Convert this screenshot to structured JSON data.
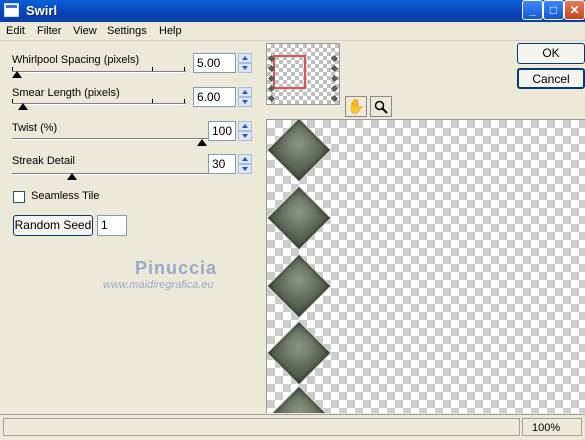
{
  "window": {
    "title": "Swirl",
    "minimize": "_",
    "maximize": "□",
    "close": "✕"
  },
  "menu": [
    "Edit",
    "Filter",
    "View",
    "Settings",
    "Help"
  ],
  "controls": {
    "whirlpool_spacing": {
      "label": "Whirlpool Spacing (pixels)",
      "value": "5.00"
    },
    "smear_length": {
      "label": "Smear Length (pixels)",
      "value": "6.00"
    },
    "twist": {
      "label": "Twist (%)",
      "value": "100"
    },
    "streak_detail": {
      "label": "Streak Detail",
      "value": "30"
    },
    "seamless_tile": {
      "label": "Seamless Tile",
      "checked": false
    },
    "random_seed": {
      "label": "Random Seed",
      "value": "1"
    }
  },
  "buttons": {
    "ok": "OK",
    "cancel": "Cancel"
  },
  "watermark": {
    "name": "Pinuccia",
    "url": "www.maidiregrafica.eu"
  },
  "tools": {
    "hand": "hand-icon",
    "zoom": "magnifier-icon"
  },
  "status": {
    "zoom": "100%"
  },
  "colors": {
    "title_bar": "#0a5fd8",
    "face": "#ece9d8",
    "diamond": "#5f6b59"
  }
}
